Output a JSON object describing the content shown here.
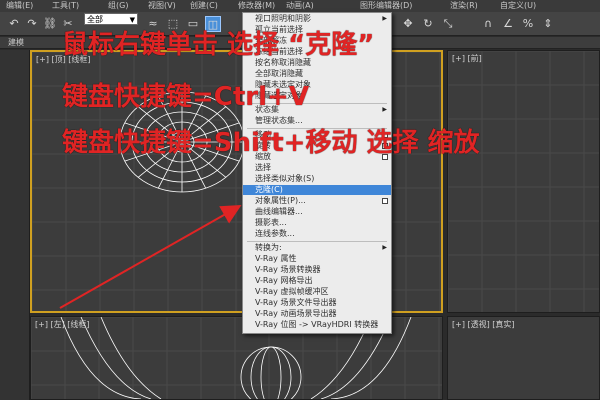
{
  "menubar": {
    "items": [
      "编辑(E)",
      "工具(T)",
      "组(G)",
      "视图(V)",
      "创建(C)",
      "修改器(M)",
      "动画(A)",
      "图形编辑器(D)",
      "渲染(R)",
      "自定义(U)"
    ]
  },
  "toolbar": {
    "selection_filter": "全部",
    "icons": [
      "undo-icon",
      "redo-icon",
      "link-icon",
      "unlink-icon",
      "bind-icon",
      "select-icon",
      "region-select-icon",
      "window-crossing-icon",
      "move-icon",
      "rotate-icon",
      "scale-icon",
      "snap-icon",
      "angle-snap-icon",
      "percent-snap-icon",
      "spinner-snap-icon"
    ]
  },
  "ribbon": {
    "tab": "建模"
  },
  "viewports": {
    "top_left_label": "[+] [顶] [线框]",
    "top_right_label": "[+] [前]",
    "bottom_left_label": "[+] [左] [线框]",
    "bottom_right_label": "[+] [透视] [真实]"
  },
  "context_menu": {
    "items": [
      {
        "label": "视口照明和阴影",
        "arrow": true
      },
      {
        "label": "孤立当前选择"
      },
      {
        "label": "全部解冻"
      },
      {
        "label": "冻结当前选择"
      },
      {
        "label": "按名称取消隐藏"
      },
      {
        "label": "全部取消隐藏"
      },
      {
        "label": "隐藏未选定对象"
      },
      {
        "label": "隐藏选定对象"
      },
      {
        "label": "状态集",
        "arrow": true,
        "sep_before": true
      },
      {
        "label": "管理状态集..."
      },
      {
        "label": "移动",
        "box": true,
        "sep_before": true
      },
      {
        "label": "旋转",
        "box": true
      },
      {
        "label": "缩放",
        "box": true
      },
      {
        "label": "选择"
      },
      {
        "label": "选择类似对象(S)"
      },
      {
        "label": "克隆(C)",
        "highlight": true
      },
      {
        "label": "对象属性(P)...",
        "box": true
      },
      {
        "label": "曲线编辑器..."
      },
      {
        "label": "摄影表..."
      },
      {
        "label": "连线参数..."
      },
      {
        "label": "转换为:",
        "arrow": true,
        "sep_before": true
      },
      {
        "label": "V-Ray 属性"
      },
      {
        "label": "V-Ray 场景转换器"
      },
      {
        "label": "V-Ray 网格导出"
      },
      {
        "label": "V-Ray 虚拟帧缓冲区"
      },
      {
        "label": "V-Ray 场景文件导出器"
      },
      {
        "label": "V-Ray 动画场景导出器"
      },
      {
        "label": "V-Ray 位图 -> VRayHDRI 转换器"
      }
    ]
  },
  "annotations": {
    "line1": "鼠标右键单击 选择 “克隆”",
    "line2": "键盘快捷键=Ctrl+V",
    "line3": "键盘快捷键=Shift+移动 选择 缩放",
    "color": "#e02424"
  }
}
